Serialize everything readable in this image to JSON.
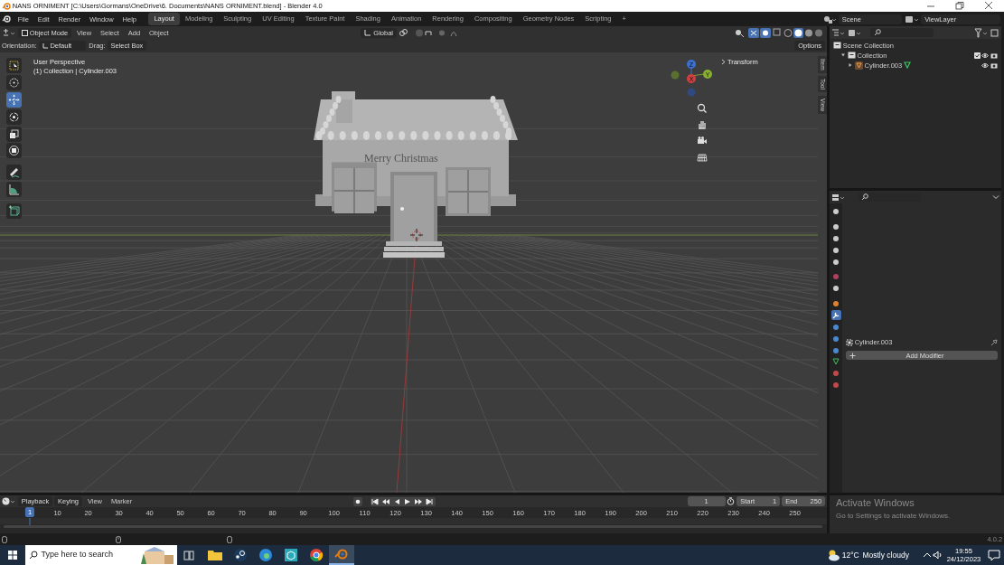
{
  "title_bar": {
    "title": "NANS ORNIMENT [C:\\Users\\Gormans\\OneDrive\\6. Documents\\NANS ORNIMENT.blend] - Blender 4.0"
  },
  "menu": [
    "File",
    "Edit",
    "Render",
    "Window",
    "Help"
  ],
  "workspaces": [
    {
      "label": "Layout",
      "selected": true
    },
    {
      "label": "Modeling",
      "selected": false
    },
    {
      "label": "Sculpting",
      "selected": false
    },
    {
      "label": "UV Editing",
      "selected": false
    },
    {
      "label": "Texture Paint",
      "selected": false
    },
    {
      "label": "Shading",
      "selected": false
    },
    {
      "label": "Animation",
      "selected": false
    },
    {
      "label": "Rendering",
      "selected": false
    },
    {
      "label": "Compositing",
      "selected": false
    },
    {
      "label": "Geometry Nodes",
      "selected": false
    },
    {
      "label": "Scripting",
      "selected": false
    },
    {
      "label": "+",
      "selected": false
    }
  ],
  "scene": "Scene",
  "view_layer": "ViewLayer",
  "viewport_header": {
    "mode": "Object Mode",
    "menus": [
      "View",
      "Select",
      "Add",
      "Object"
    ],
    "transform": "Global"
  },
  "tool_settings": {
    "orientation_label": "Orientation:",
    "orientation": "Default",
    "drag_label": "Drag:",
    "drag": "Select Box",
    "options": "Options"
  },
  "tools": [
    {
      "selected": false
    },
    {
      "selected": false
    },
    {
      "selected": true
    },
    {
      "selected": false
    },
    {
      "selected": false
    },
    {
      "selected": false
    },
    {
      "selected": false
    },
    {
      "selected": false
    },
    {
      "selected": false
    }
  ],
  "viewport": {
    "view_name": "User Perspective",
    "collection_info": "(1) Collection | Cylinder.003",
    "model_text": "Merry Christmas",
    "transform_panel": "Transform",
    "side_tabs": [
      "Item",
      "Tool",
      "View"
    ],
    "gizmo_axes": [
      "Z",
      "X",
      "Y"
    ]
  },
  "outliner": {
    "items": [
      {
        "label": "Scene Collection",
        "children": [
          {
            "label": "Collection",
            "expanded": true,
            "children": [
              {
                "label": "Cylinder.003",
                "expanded": false
              }
            ]
          }
        ]
      }
    ]
  },
  "properties": {
    "object": "Cylinder.003",
    "add_modifier": "Add Modifier",
    "tabs": [
      {
        "selected": false
      },
      {
        "selected": false
      },
      {
        "selected": false
      },
      {
        "selected": false
      },
      {
        "selected": false
      },
      {
        "selected": false
      },
      {
        "selected": false
      },
      {
        "selected": false
      },
      {
        "selected": true
      },
      {
        "selected": false
      },
      {
        "selected": false
      },
      {
        "selected": false
      },
      {
        "selected": false
      },
      {
        "selected": false
      },
      {
        "selected": false
      }
    ]
  },
  "timeline": {
    "menus": [
      "Playback",
      "Keying",
      "View",
      "Marker"
    ],
    "current_frame": "1",
    "start_label": "Start",
    "start": "1",
    "end_label": "End",
    "end": "250",
    "ticks": [
      "1",
      "10",
      "20",
      "30",
      "40",
      "50",
      "60",
      "70",
      "80",
      "90",
      "100",
      "110",
      "120",
      "130",
      "140",
      "150",
      "160",
      "170",
      "180",
      "190",
      "200",
      "210",
      "220",
      "230",
      "240",
      "250"
    ]
  },
  "activation_notice": {
    "title": "Activate Windows",
    "text": "Go to Settings to activate Windows."
  },
  "status_bar": {
    "version": "4.0.2"
  },
  "taskbar": {
    "search_placeholder": "Type here to search",
    "apps": [
      {
        "selected": false
      },
      {
        "selected": false
      },
      {
        "selected": false
      },
      {
        "selected": false
      },
      {
        "selected": false
      },
      {
        "selected": false
      },
      {
        "selected": true
      }
    ],
    "temperature": "12°C",
    "weather": "Mostly cloudy",
    "time": "19:55",
    "date": "24/12/2023"
  }
}
